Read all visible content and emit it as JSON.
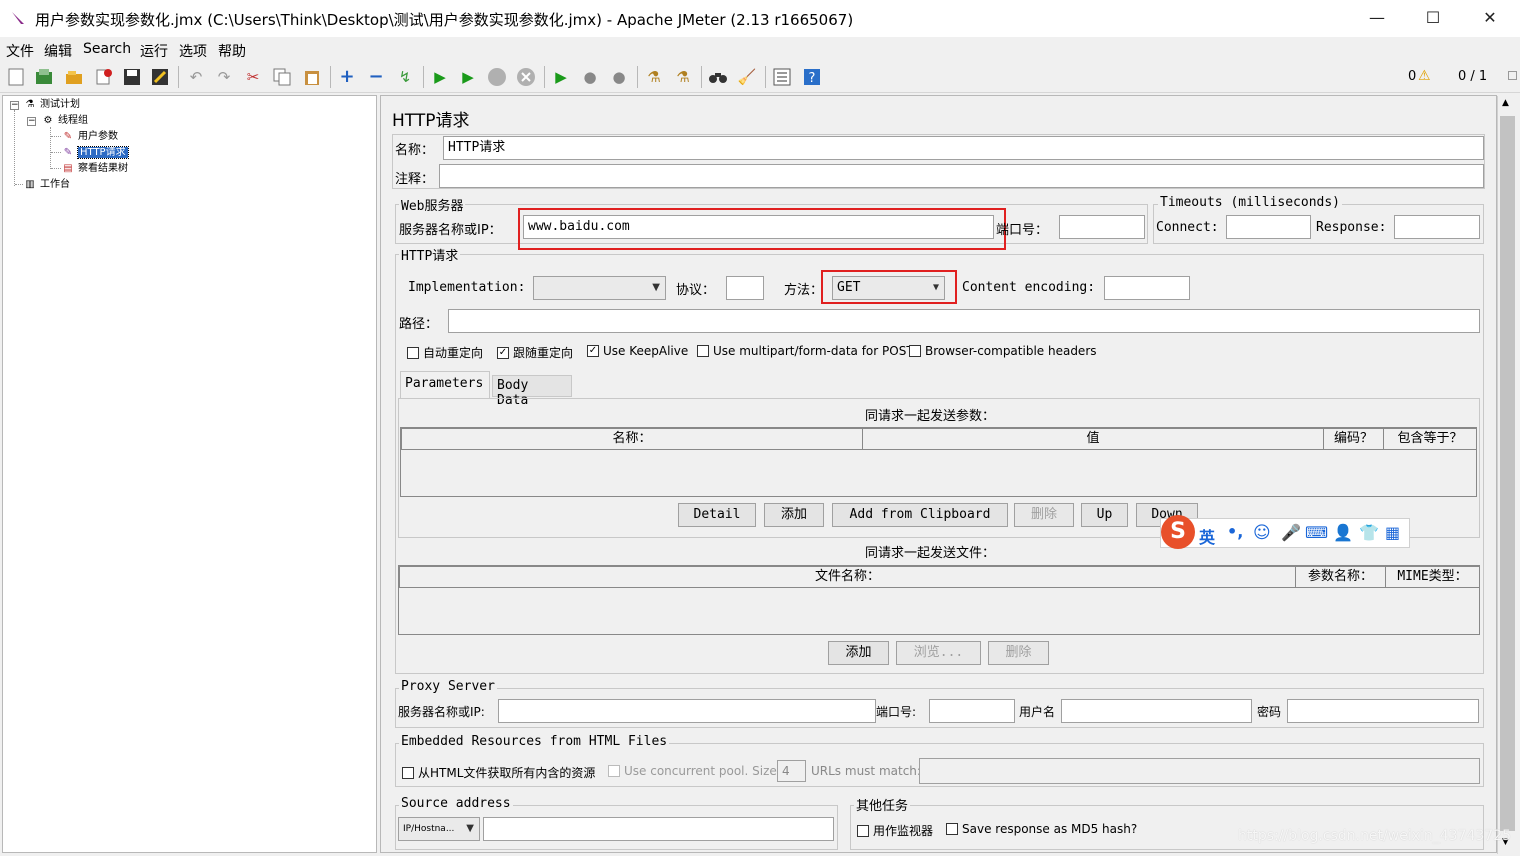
{
  "window": {
    "title": "用户参数实现参数化.jmx (C:\\Users\\Think\\Desktop\\测试\\用户参数实现参数化.jmx) - Apache JMeter (2.13 r1665067)",
    "min_label": "—",
    "max_label": "☐",
    "close_label": "✕"
  },
  "menu": [
    "文件",
    "编辑",
    "Search",
    "运行",
    "选项",
    "帮助"
  ],
  "toolbar": {
    "icons": [
      "new-icon",
      "templates-icon",
      "open-icon",
      "close-icon",
      "save-icon",
      "save-as-icon",
      "undo-icon",
      "redo-icon",
      "cut-icon",
      "copy-icon",
      "paste-icon",
      "expand-icon",
      "collapse-icon",
      "toggle-icon",
      "start-icon",
      "start-no-pause-icon",
      "stop-icon",
      "shutdown-icon",
      "remote-start-icon",
      "remote-stop-icon",
      "remote-shutdown-icon",
      "clear-icon",
      "clear-all-icon",
      "search-icon",
      "reset-search-icon",
      "function-helper-icon",
      "help-icon"
    ],
    "warn_count": "0",
    "threads": "0 / 1"
  },
  "tree": {
    "items": [
      {
        "label": "测试计划"
      },
      {
        "label": "线程组"
      },
      {
        "label": "用户参数"
      },
      {
        "label": "HTTP请求"
      },
      {
        "label": "察看结果树"
      },
      {
        "label": "工作台"
      }
    ]
  },
  "panel": {
    "title": "HTTP请求",
    "name_label": "名称：",
    "name_value": "HTTP请求",
    "comment_label": "注释：",
    "web_server": {
      "title": "Web服务器",
      "server_label": "服务器名称或IP：",
      "server_value": "www.baidu.com",
      "port_label": "端口号："
    },
    "timeouts": {
      "title": "Timeouts (milliseconds)",
      "connect_label": "Connect:",
      "response_label": "Response:"
    },
    "http_request": {
      "title": "HTTP请求",
      "impl_label": "Implementation:",
      "protocol_label": "协议：",
      "method_label": "方法：",
      "method_value": "GET",
      "encoding_label": "Content encoding:",
      "path_label": "路径："
    },
    "options": [
      {
        "label": "自动重定向",
        "checked": false
      },
      {
        "label": "跟随重定向",
        "checked": true
      },
      {
        "label": "Use KeepAlive",
        "checked": true
      },
      {
        "label": "Use multipart/form-data for POST",
        "checked": false
      },
      {
        "label": "Browser-compatible headers",
        "checked": false
      }
    ],
    "tabs": [
      "Parameters",
      "Body Data"
    ],
    "params": {
      "caption": "同请求一起发送参数：",
      "columns": [
        "名称：",
        "值",
        "编码？",
        "包含等于？"
      ],
      "buttons": [
        "Detail",
        "添加",
        "Add from Clipboard",
        "删除",
        "Up",
        "Down"
      ]
    },
    "files": {
      "caption": "同请求一起发送文件：",
      "columns": [
        "文件名称：",
        "参数名称：",
        "MIME类型："
      ],
      "buttons": [
        "添加",
        "浏览...",
        "删除"
      ]
    },
    "proxy": {
      "title": "Proxy Server",
      "server_label": "服务器名称或IP:",
      "port_label": "端口号:",
      "user_label": "用户名",
      "password_label": "密码"
    },
    "embedded": {
      "title": "Embedded Resources from HTML Files",
      "fetch_label": "从HTML文件获取所有内含的资源",
      "pool_label": "Use concurrent pool. Size:",
      "pool_value": "4",
      "urls_label": "URLs must match:"
    },
    "source": {
      "title": "Source address",
      "type_value": "IP/Hostna..."
    },
    "other": {
      "title": "其他任务",
      "monitor_label": "用作监视器",
      "md5_label": "Save response as MD5 hash?"
    }
  },
  "ime": {
    "lang": "英",
    "punct": "•,"
  },
  "watermark": "https://blog.csdn.net/weixin_43743725",
  "colors": {
    "highlight": "#e02020",
    "selection": "#2d6bc4"
  }
}
